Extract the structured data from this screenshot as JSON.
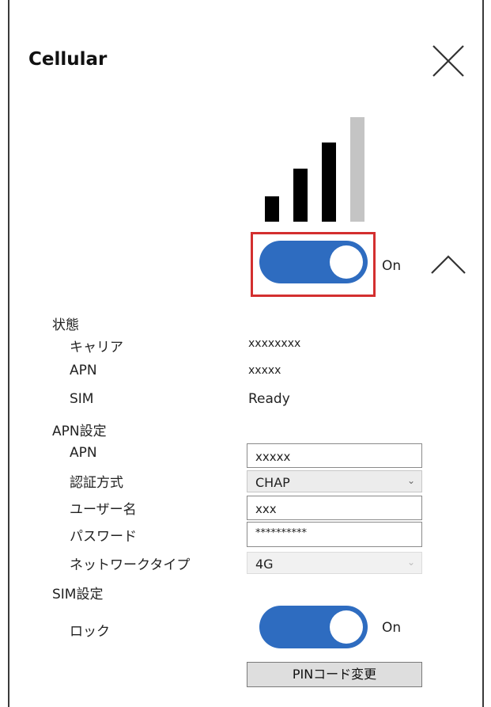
{
  "header": {
    "title": "Cellular",
    "close_icon": "close-icon"
  },
  "signal": {
    "level": 3,
    "max": 4,
    "active_color": "#000000",
    "inactive_color": "#c4c4c4"
  },
  "cellular_toggle": {
    "state": "On",
    "on": true,
    "color": "#2e6cc0",
    "highlight_color": "#d32f2f"
  },
  "collapse_icon": "chevron-up-icon",
  "status": {
    "section_label": "状態",
    "carrier_label": "キャリア",
    "carrier_value": "xxxxxxxx",
    "apn_label": "APN",
    "apn_value": "xxxxx",
    "sim_label": "SIM",
    "sim_value": "Ready"
  },
  "apn_settings": {
    "section_label": "APN設定",
    "apn_label": "APN",
    "apn_value": "xxxxx",
    "auth_label": "認証方式",
    "auth_value": "CHAP",
    "username_label": "ユーザー名",
    "username_value": "xxx",
    "password_label": "パスワード",
    "password_value": "**********",
    "network_type_label": "ネットワークタイプ",
    "network_type_value": "4G"
  },
  "sim_settings": {
    "section_label": "SIM設定",
    "lock_label": "ロック",
    "lock_state": "On",
    "lock_on": true,
    "pin_button": "PINコード変更"
  }
}
